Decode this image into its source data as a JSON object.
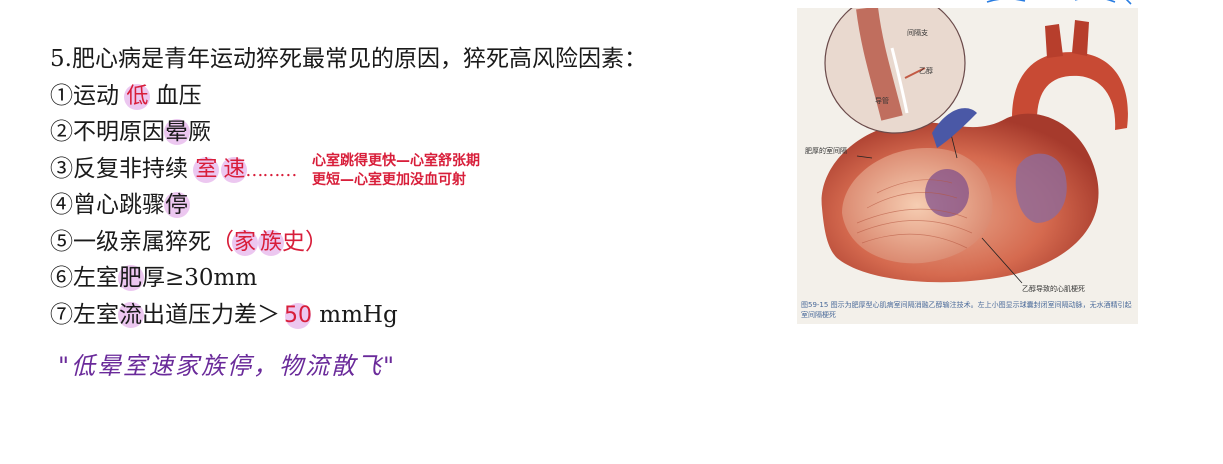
{
  "title": "5.肥心病是青年运动猝死最常见的原因，猝死高风险因素：",
  "items": [
    {
      "pre": "①运动 ",
      "hl": "低",
      "post": " 血压"
    },
    {
      "pre": "②不明原因",
      "hl": "晕",
      "post": "厥"
    },
    {
      "pre": "③反复非持续 ",
      "hl1": "室",
      "hl2": "速",
      "dots": "………"
    },
    {
      "pre": "④曾心跳骤",
      "hl": "停",
      "post": ""
    },
    {
      "pre": "⑤一级亲属猝死",
      "paren_open": "（",
      "hl1": "家",
      "hl2": "族",
      "paren_end": "史）"
    },
    {
      "pre": "⑥左室",
      "hl": "肥",
      "post": "厚≥30mm"
    },
    {
      "pre": "⑦左室",
      "hl": "流",
      "mid": "出道压力差＞",
      "hl2": "50",
      "post": " mmHg"
    }
  ],
  "note": {
    "line1": "心室跳得更快—心室舒张期",
    "line2": "更短—心室更加没血可射"
  },
  "mnemonic": "\"低晕室速家族停，物流散飞\"",
  "figure": {
    "label_septum": "肥厚的室间隔",
    "label_infarct": "乙醇导致的心肌梗死",
    "inset_label_1": "间隔支",
    "inset_label_2": "乙醇",
    "inset_label_3": "导管",
    "caption": "图59-15 图示为肥厚型心肌病室间隔消融乙醇输注技术。左上小图显示球囊封闭室间隔动脉，无水酒精引起室间隔梗死"
  },
  "colors": {
    "highlight": "#e7b9ec",
    "red_text": "#d81e3a",
    "mnemonic": "#6a2a9a"
  }
}
